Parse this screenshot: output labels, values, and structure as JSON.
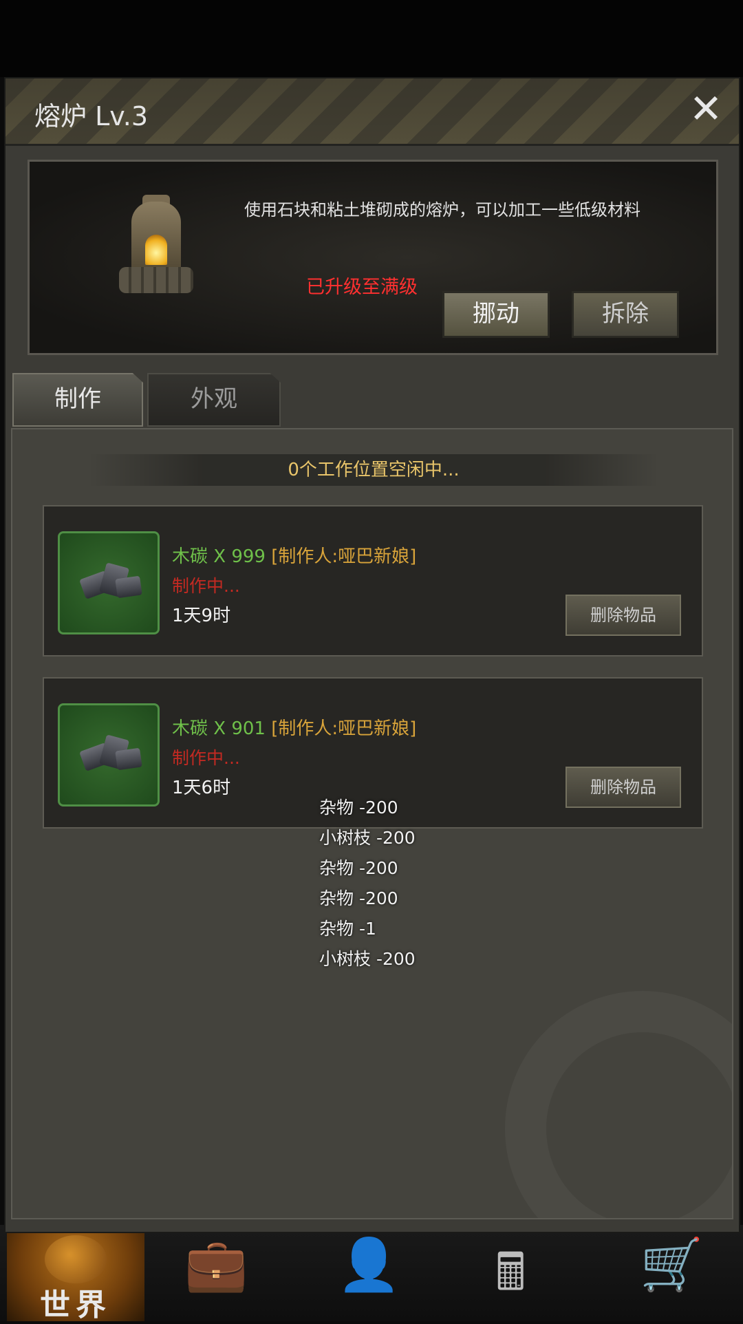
{
  "dialog": {
    "title": "熔炉 Lv.3",
    "close_icon": "close-icon"
  },
  "info": {
    "description": "使用石块和粘土堆砌成的熔炉，可以加工一些低级材料",
    "max_level_text": "已升级至满级",
    "move_label": "挪动",
    "dismantle_label": "拆除"
  },
  "tabs": [
    {
      "label": "制作",
      "active": true
    },
    {
      "label": "外观",
      "active": false
    }
  ],
  "craft": {
    "status_text": "0个工作位置空闲中...",
    "jobs": [
      {
        "item": "木碳 X 999",
        "maker": "[制作人:哑巴新娘]",
        "status": "制作中...",
        "time": "1天9时",
        "delete_label": "删除物品",
        "icon": "charcoal-icon"
      },
      {
        "item": "木碳 X 901",
        "maker": "[制作人:哑巴新娘]",
        "status": "制作中...",
        "time": "1天6时",
        "delete_label": "删除物品",
        "icon": "charcoal-icon"
      }
    ]
  },
  "toasts": [
    "杂物 -200",
    "小树枝 -200",
    "杂物 -200",
    "杂物 -200",
    "杂物 -1",
    "小树枝 -200"
  ],
  "bottom_nav": {
    "world_label": "世界",
    "icons": [
      "globe-icon",
      "backpack-icon",
      "head-gear-icon",
      "calculator-icon",
      "cart-icon"
    ]
  },
  "colors": {
    "item_name": "#6fc04a",
    "maker": "#d9a43a",
    "status": "#c42a22",
    "max_level": "#ff3030",
    "work_status": "#e9c56a"
  }
}
